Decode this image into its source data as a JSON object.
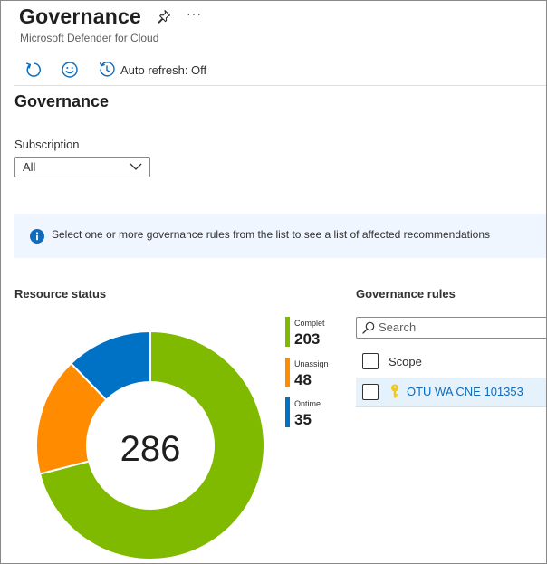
{
  "header": {
    "title": "Governance",
    "subtitle": "Microsoft Defender for Cloud",
    "more_label": "···"
  },
  "toolbar": {
    "auto_refresh_label": "Auto refresh: Off"
  },
  "page": {
    "heading": "Governance"
  },
  "subscription": {
    "label": "Subscription",
    "value": "All"
  },
  "info_banner": {
    "text": "Select one or more governance rules from the list to see a list of affected recommendations"
  },
  "resource_status": {
    "title": "Resource status",
    "total": "286"
  },
  "chart_data": {
    "type": "pie",
    "categories": [
      "Completed",
      "Unassigned",
      "Ontime"
    ],
    "values": [
      203,
      48,
      35
    ],
    "colors": [
      "#7fba00",
      "#ff8c00",
      "#0072c6"
    ],
    "legend_labels": [
      "Complet",
      "Unassign",
      "Ontime"
    ],
    "total": 286
  },
  "governance_rules": {
    "title": "Governance rules",
    "search_placeholder": "Search",
    "column_header": "Scope",
    "rows": [
      {
        "label": "OTU WA CNE 101353",
        "selected": false
      }
    ]
  },
  "colors": {
    "accent": "#0f6cbd",
    "completed": "#7fba00",
    "unassigned": "#ff8c00",
    "ontime": "#0072c6",
    "key": "#f2c811"
  }
}
